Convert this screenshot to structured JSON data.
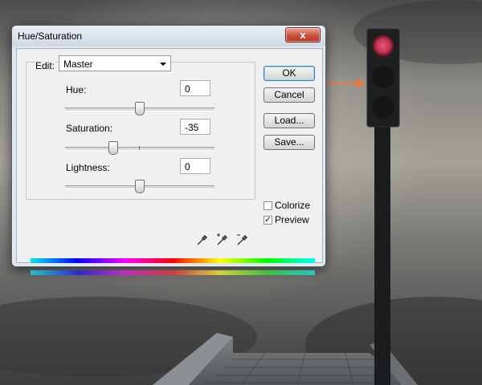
{
  "dialog": {
    "title": "Hue/Saturation",
    "close_glyph": "x",
    "edit_label": "Edit:",
    "edit_value": "Master",
    "hue": {
      "label": "Hue:",
      "value": "0",
      "level": 0.5
    },
    "saturation": {
      "label": "Saturation:",
      "value": "-35",
      "level": 0.325
    },
    "lightness": {
      "label": "Lightness:",
      "value": "0",
      "level": 0.5
    },
    "buttons": {
      "ok": "OK",
      "cancel": "Cancel",
      "load": "Load...",
      "save": "Save..."
    },
    "colorize": {
      "label": "Colorize",
      "checked": false
    },
    "preview": {
      "label": "Preview",
      "checked": true
    },
    "icons": [
      "eyedropper-icon",
      "eyedropper-plus-icon",
      "eyedropper-minus-icon"
    ]
  },
  "colors": {
    "traffic_light_red": "#c4334f",
    "annotation_arrow": "#f07a3a"
  }
}
